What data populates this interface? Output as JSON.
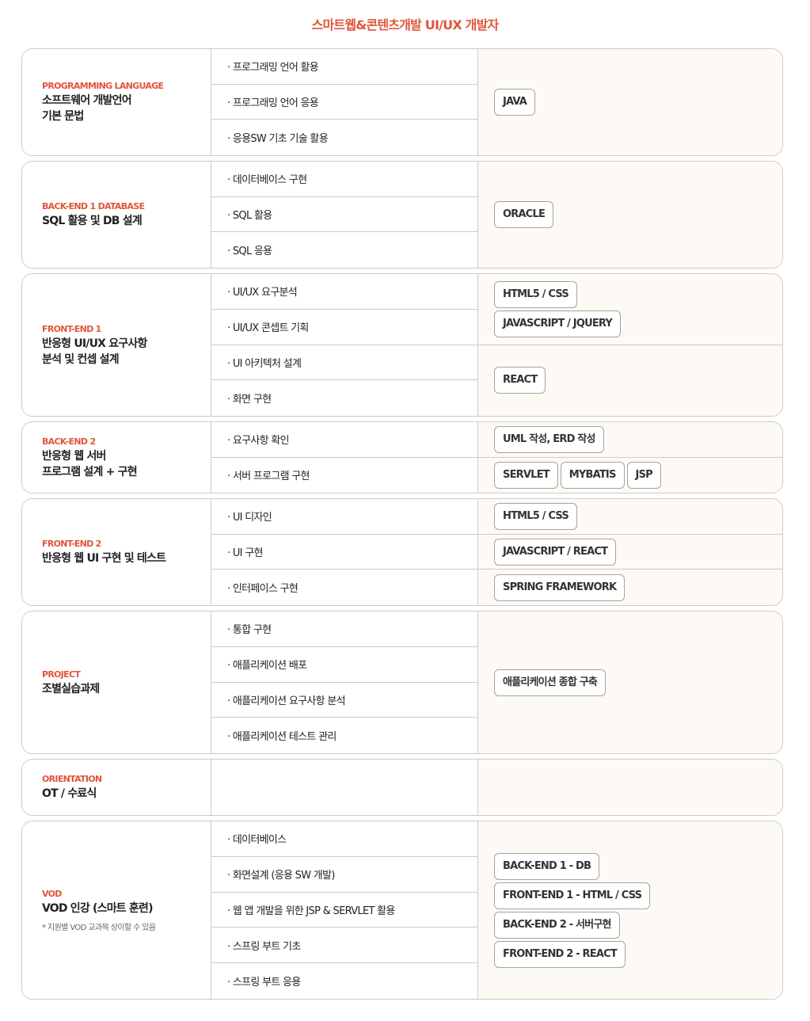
{
  "page_title": "스마트웹&콘텐츠개발 UI/UX 개발자",
  "modules": [
    {
      "label": "PROGRAMMING LANGUAGE",
      "title": "소프트웨어 개발언어\n기본 문법",
      "tasks": [
        "· 프로그래밍 언어 활용",
        "· 프로그래밍 언어 응용",
        "· 응용SW 기초 기술 활용"
      ],
      "tool_groups": [
        {
          "span": 3,
          "rows": [
            [
              "JAVA"
            ]
          ]
        }
      ]
    },
    {
      "label": "BACK-END 1 DATABASE",
      "title": "SQL 활용 및 DB 설계",
      "tasks": [
        "· 데이터베이스 구현",
        "· SQL 활용",
        "· SQL 응용"
      ],
      "tool_groups": [
        {
          "span": 3,
          "rows": [
            [
              "ORACLE"
            ]
          ]
        }
      ]
    },
    {
      "label": "FRONT-END 1",
      "title": "반응형 UI/UX 요구사항\n분석 및 컨셉 설계",
      "tasks": [
        "· UI/UX 요구분석",
        "· UI/UX 콘셉트 기획",
        "· UI 아키텍처 설계",
        "· 화면 구현"
      ],
      "tool_groups": [
        {
          "span": 2,
          "rows": [
            [
              "HTML5 / CSS"
            ],
            [
              "JAVASCRIPT / JQUERY"
            ]
          ]
        },
        {
          "span": 2,
          "rows": [
            [
              "REACT"
            ]
          ]
        }
      ]
    },
    {
      "label": "BACK-END 2",
      "title": "반응형 웹 서버\n프로그램 설계 + 구현",
      "tasks": [
        "· 요구사항 확인",
        "· 서버 프로그램 구현"
      ],
      "tool_groups": [
        {
          "span": 1,
          "rows": [
            [
              "UML 작성, ERD 작성"
            ]
          ]
        },
        {
          "span": 1,
          "rows": [
            [
              "SERVLET",
              "MYBATIS",
              "JSP"
            ]
          ]
        }
      ]
    },
    {
      "label": "FRONT-END 2",
      "title": "반응형 웹 UI 구현 및 테스트",
      "tasks": [
        "· UI 디자인",
        "· UI 구현",
        "· 인터페이스 구현"
      ],
      "tool_groups": [
        {
          "span": 1,
          "rows": [
            [
              "HTML5 / CSS"
            ]
          ]
        },
        {
          "span": 1,
          "rows": [
            [
              "JAVASCRIPT / REACT"
            ]
          ]
        },
        {
          "span": 1,
          "rows": [
            [
              "SPRING FRAMEWORK"
            ]
          ]
        }
      ]
    },
    {
      "label": "PROJECT",
      "title": "조별실습과제",
      "tasks": [
        "· 통합 구현",
        "· 애플리케이션 배포",
        "· 애플리케이션 요구사항 분석",
        "· 애플리케이션 테스트 관리"
      ],
      "tool_groups": [
        {
          "span": 4,
          "rows": [
            [
              "애플리케이션 종합 구축"
            ]
          ]
        }
      ]
    },
    {
      "label": "ORIENTATION",
      "title": "OT / 수료식",
      "tasks": [
        ""
      ],
      "tool_groups": [
        {
          "span": 1,
          "rows": []
        }
      ]
    },
    {
      "label": "VOD",
      "title": "VOD 인강 (스마트 훈련)",
      "note": "* 지원별 VOD 교과목 상이할 수 있음",
      "tasks": [
        "· 데이터베이스",
        "· 화면설계 (응용 SW 개발)",
        "· 웹 앱 개발을 위한 JSP & SERVLET 활용",
        "· 스프링 부트 기초",
        "· 스프링 부트 응용"
      ],
      "tool_groups": [
        {
          "span": 5,
          "rows": [
            [
              "BACK-END 1 - DB"
            ],
            [
              "FRONT-END 1 - HTML / CSS"
            ],
            [
              "BACK-END 2 - 서버구현"
            ],
            [
              "FRONT-END 2 - REACT"
            ]
          ]
        }
      ]
    }
  ]
}
